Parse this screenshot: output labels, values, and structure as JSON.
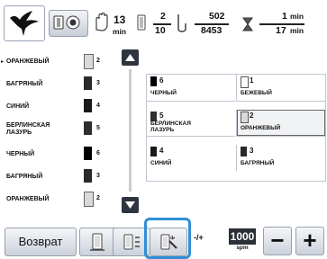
{
  "header": {
    "logo_icon": "bird-embroidery-icon",
    "thread_view_icon": "thread-spool-view-icon",
    "hand_icon": "presser-foot-hand-icon",
    "time_total": "13",
    "time_unit": "min",
    "color_current": "2",
    "color_total": "10",
    "stitch_current": "502",
    "stitch_total": "8453",
    "remaining_time": "1",
    "remaining_unit": "min",
    "total_time": "17",
    "total_unit": "min"
  },
  "thread_list": [
    {
      "name": "ОРАНЖЕВЫЙ",
      "num": "2",
      "color": "#d9d9d9",
      "current": true
    },
    {
      "name": "БАГРЯНЫЙ",
      "num": "3",
      "color": "#2a2a2a"
    },
    {
      "name": "СИНИЙ",
      "num": "4",
      "color": "#1a1a1a"
    },
    {
      "name": "БЕРЛИНСКАЯ\nЛАЗУРЬ",
      "num": "5",
      "color": "#2e2e2e"
    },
    {
      "name": "ЧЕРНЫЙ",
      "num": "6",
      "color": "#000000"
    },
    {
      "name": "БАГРЯНЫЙ",
      "num": "3",
      "color": "#2a2a2a"
    },
    {
      "name": "ОРАНЖЕВЫЙ",
      "num": "2",
      "color": "#d9d9d9"
    }
  ],
  "spool_grid": [
    {
      "num": "6",
      "name": "ЧЕРНЫЙ",
      "color": "#000000",
      "selected": false
    },
    {
      "num": "1",
      "name": "БЕЖЕВЫЙ",
      "color": "#ffffff",
      "selected": false
    },
    {
      "num": "5",
      "name": "БЕРЛИНСКАЯ\nЛАЗУРЬ",
      "color": "#2e2e2e",
      "selected": false
    },
    {
      "num": "2",
      "name": "ОРАНЖЕВЫЙ",
      "color": "#d9d9d9",
      "selected": true
    },
    {
      "num": "4",
      "name": "СИНИЙ",
      "color": "#1a1a1a",
      "selected": false
    },
    {
      "num": "3",
      "name": "БАГРЯНЫЙ",
      "color": "#2a2a2a",
      "selected": false
    }
  ],
  "bottom": {
    "return_label": "Возврат",
    "speed_value": "1000",
    "speed_unit": "spm",
    "adjust_label": "-/+",
    "minus_label": "−",
    "plus_label": "+"
  },
  "colors": {
    "highlight": "#2f8fd6",
    "dark_button": "#2e3440"
  }
}
